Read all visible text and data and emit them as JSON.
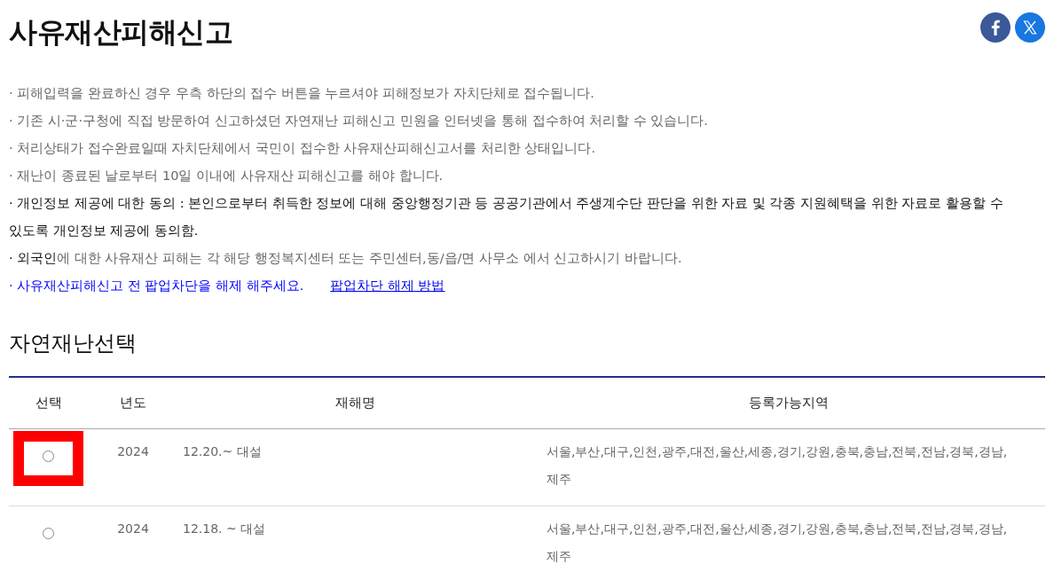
{
  "header": {
    "title": "사유재산피해신고"
  },
  "notices": [
    {
      "kind": "info",
      "text": "· 피해입력을 완료하신 경우 우측 하단의 접수 버튼을 누르셔야 피해정보가 자치단체로 접수됩니다."
    },
    {
      "kind": "info",
      "text": "· 기존 시·군·구청에 직접 방문하여 신고하셨던 자연재난 피해신고 민원을 인터넷을 통해 접수하여 처리할 수 있습니다."
    },
    {
      "kind": "info",
      "text": "· 처리상태가 접수완료일때 자치단체에서 국민이 접수한 사유재산피해신고서를 처리한 상태입니다."
    },
    {
      "kind": "info",
      "text": "· 재난이 종료된 날로부터 10일 이내에 사유재산 피해신고를 해야 합니다."
    },
    {
      "kind": "consent",
      "text": "· 개인정보 제공에 대한 동의 : 본인으로부터 취득한 정보에 대해 중앙행정기관 등 공공기관에서 주생계수단 판단을 위한 자료 및 각종 지원혜택을 위한 자료로 활용할 수 있도록 개인정보 제공에 동의함."
    },
    {
      "kind": "foreigner",
      "lead": "· 외국인",
      "text": "에 대한 사유재산 피해는 각 해당 행정복지센터 또는 주민센터,동/읍/면 사무소 에서 신고하시기 바랍니다."
    },
    {
      "kind": "popup",
      "text": "· 사유재산피해신고 전 팝업차단을 해제 해주세요.",
      "link": "팝업차단 해제 방법"
    }
  ],
  "section": {
    "title": "자연재난선택"
  },
  "table": {
    "columns": [
      "선택",
      "년도",
      "재해명",
      "등록가능지역"
    ],
    "rows": [
      {
        "selected": false,
        "highlighted": true,
        "year": "2024",
        "name": "12.20.~ 대설",
        "regions": "서울,부산,대구,인천,광주,대전,울산,세종,경기,강원,충북,충남,전북,전남,경북,경남,제주"
      },
      {
        "selected": false,
        "highlighted": false,
        "year": "2024",
        "name": "12.18. ~ 대설",
        "regions": "서울,부산,대구,인천,광주,대전,울산,세종,경기,강원,충북,충남,전북,전남,경북,경남,제주"
      }
    ]
  }
}
